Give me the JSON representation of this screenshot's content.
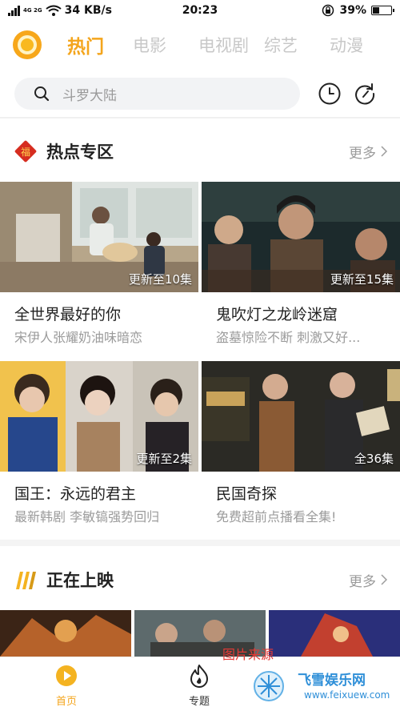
{
  "status_bar": {
    "network": "4G 2G",
    "speed": "34 KB/s",
    "time": "20:23",
    "battery": "39%",
    "battery_level": 0.39
  },
  "header": {
    "tabs": [
      {
        "label": "热门",
        "active": true
      },
      {
        "label": "电影",
        "active": false
      },
      {
        "label": "电视剧",
        "active": false
      },
      {
        "label": "综艺",
        "active": false
      },
      {
        "label": "动漫",
        "active": false
      }
    ]
  },
  "search": {
    "placeholder": "斗罗大陆"
  },
  "hot_section": {
    "badge": "福",
    "title": "热点专区",
    "more": "更多",
    "items": [
      {
        "title": "全世界最好的你",
        "subtitle": "宋伊人张耀奶油味暗恋",
        "tag": "更新至10集"
      },
      {
        "title": "鬼吹灯之龙岭迷窟",
        "subtitle": "盗墓惊险不断 刺激又好...",
        "tag": "更新至15集"
      },
      {
        "title": "国王：永远的君主",
        "subtitle": "最新韩剧 李敏镐强势回归",
        "tag": "更新至2集"
      },
      {
        "title": "民国奇探",
        "subtitle": "免费超前点播看全集!",
        "tag": "全36集"
      }
    ]
  },
  "now_showing": {
    "title": "正在上映",
    "more": "更多"
  },
  "bottom_nav": {
    "items": [
      {
        "label": "首页",
        "active": true
      },
      {
        "label": "专题",
        "active": false
      }
    ]
  },
  "watermarks": {
    "red": "图片来源",
    "blue_title": "飞雪娱乐网",
    "blue_url": "www.feixuew.com"
  },
  "colors": {
    "accent": "#f4a51c",
    "inactive_tab": "#c8c8c8",
    "muted_text": "#9b9b9b"
  }
}
